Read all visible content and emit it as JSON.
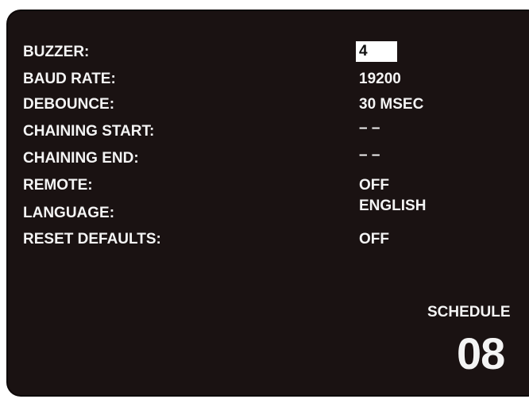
{
  "settings": {
    "items": [
      {
        "label": "BUZZER:",
        "value": "4"
      },
      {
        "label": "BAUD RATE:",
        "value": "19200"
      },
      {
        "label": "DEBOUNCE:",
        "value": "30 MSEC"
      },
      {
        "label": "CHAINING START:",
        "value": "– –"
      },
      {
        "label": "CHAINING END:",
        "value": "– –"
      },
      {
        "label": "REMOTE:",
        "value": "OFF"
      },
      {
        "label": "LANGUAGE:",
        "value": "ENGLISH"
      },
      {
        "label": "RESET DEFAULTS:",
        "value": "OFF"
      }
    ]
  },
  "schedule": {
    "title": "SCHEDULE",
    "number": "08"
  },
  "colors": {
    "background": "#1a1212",
    "text": "#f4f4f4",
    "selection_bg": "#ffffff",
    "selection_text": "#111111"
  }
}
